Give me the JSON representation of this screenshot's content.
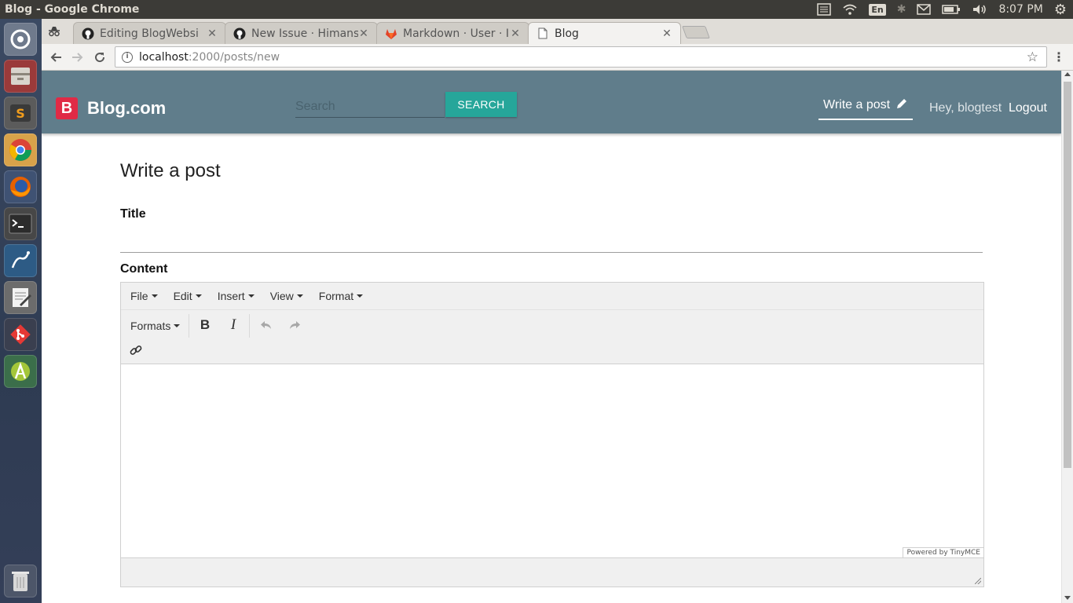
{
  "window": {
    "title": "Blog - Google Chrome"
  },
  "system": {
    "keyboard_layout": "En",
    "clock": "8:07 PM"
  },
  "tabs": [
    {
      "label": "Editing BlogWebsi",
      "favicon": "github-icon",
      "active": false
    },
    {
      "label": "New Issue · Himans",
      "favicon": "github-icon",
      "active": false
    },
    {
      "label": "Markdown · User · I",
      "favicon": "gitlab-icon",
      "active": false
    },
    {
      "label": "Blog",
      "favicon": "page-icon",
      "active": true
    }
  ],
  "address_bar": {
    "host": "localhost",
    "path": ":2000/posts/new"
  },
  "site": {
    "brand_letter": "B",
    "brand_name": "Blog.com",
    "search_placeholder": "Search",
    "search_button": "SEARCH",
    "write_link": "Write a post",
    "greeting": "Hey, blogtest",
    "logout": "Logout",
    "nav_color": "#607d8b",
    "accent_color": "#26a69a",
    "logo_color": "#e02a46"
  },
  "page": {
    "heading": "Write a post",
    "title_label": "Title",
    "content_label": "Content"
  },
  "editor": {
    "menus": [
      "File",
      "Edit",
      "Insert",
      "View",
      "Format"
    ],
    "formats_label": "Formats",
    "bold": "B",
    "italic": "I",
    "powered_by": "Powered by TinyMCE"
  }
}
